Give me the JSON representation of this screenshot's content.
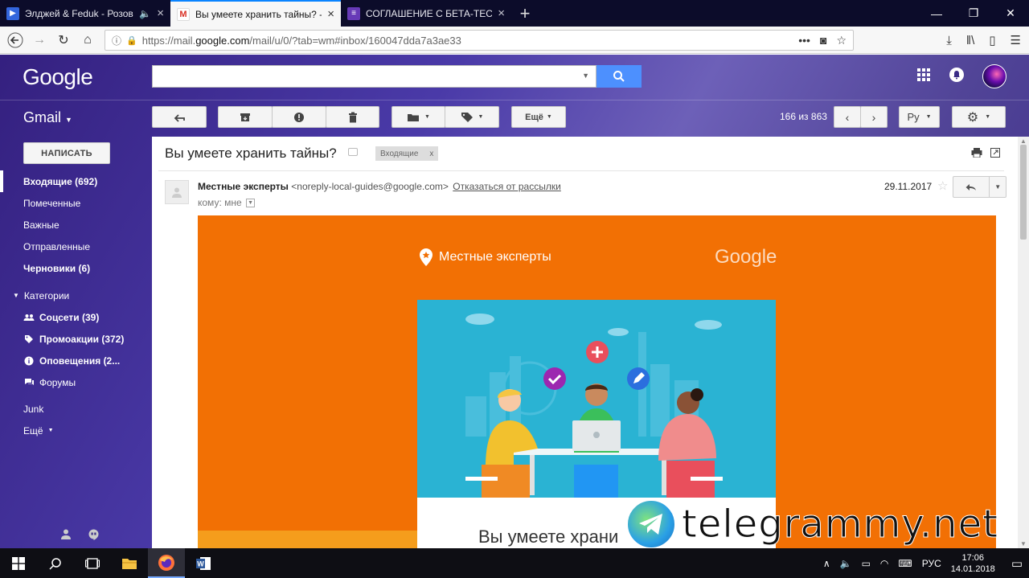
{
  "browser": {
    "tabs": [
      {
        "title": "Элджей & Feduk - Розовое",
        "icon": "youtube-icon",
        "active": false
      },
      {
        "title": "Вы умеете хранить тайны? - ",
        "icon": "gmail-icon",
        "active": true
      },
      {
        "title": "СОГЛАШЕНИЕ С БЕТА-ТЕСТИ",
        "icon": "docs-icon",
        "active": false
      }
    ],
    "url_prefix": "https://mail.",
    "url_domain": "google.com",
    "url_path": "/mail/u/0/?tab=wm#inbox/160047dda7a3ae33"
  },
  "gmail": {
    "logo": "Google",
    "app_label": "Gmail",
    "compose_label": "НАПИСАТЬ",
    "search_placeholder": "",
    "toolbar": {
      "more_label": "Ещё",
      "pager": "166 из 863",
      "lang_label": "Ру"
    },
    "nav": [
      {
        "label": "Входящие (692)",
        "bold": true,
        "selected": true
      },
      {
        "label": "Помеченные"
      },
      {
        "label": "Важные"
      },
      {
        "label": "Отправленные"
      },
      {
        "label": "Черновики (6)",
        "bold": true
      }
    ],
    "categories_label": "Категории",
    "categories": [
      {
        "label": "Соцсети (39)",
        "icon": "people-icon"
      },
      {
        "label": "Промоакции (372)",
        "icon": "tag-icon"
      },
      {
        "label": "Оповещения (2...",
        "icon": "info-icon"
      },
      {
        "label": "Форумы",
        "icon": "forum-icon"
      }
    ],
    "extra_nav": [
      {
        "label": "Junk"
      },
      {
        "label": "Ещё"
      }
    ]
  },
  "message": {
    "subject": "Вы умеете хранить тайны?",
    "label_chip": "Входящие",
    "label_chip_close": "x",
    "sender_name": "Местные эксперты",
    "sender_email": "<noreply-local-guides@google.com>",
    "unsubscribe": "Отказаться от рассылки",
    "to_prefix": "кому:",
    "to_value": "мне",
    "date": "29.11.2017"
  },
  "email_content": {
    "brand": "Местные эксперты",
    "google_logo": "Google",
    "card_title": "Вы умеете храни"
  },
  "watermark": "telegrammy.net",
  "taskbar": {
    "lang": "РУС",
    "time": "17:06",
    "date": "14.01.2018"
  },
  "colors": {
    "email_orange": "#f27004",
    "illustration_blue": "#2ab3d3",
    "search_blue": "#4d90fe"
  }
}
